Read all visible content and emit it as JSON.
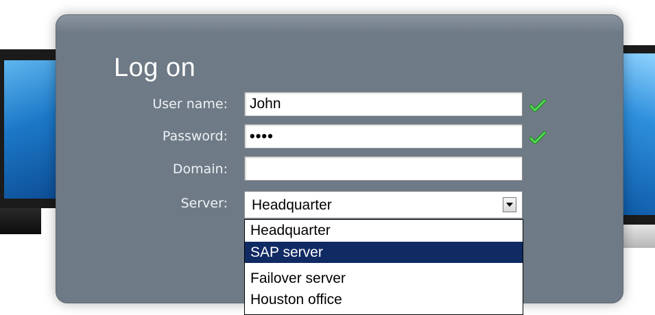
{
  "dialog": {
    "title": "Log on"
  },
  "form": {
    "username_label": "User name:",
    "username_value": "John",
    "password_label": "Password:",
    "password_value": "••••",
    "domain_label": "Domain:",
    "domain_value": "",
    "server_label": "Server:",
    "server_value": "Headquarter"
  },
  "server_dropdown": {
    "options": [
      "Headquarter",
      "SAP server",
      "Failover server",
      "Houston office"
    ],
    "highlighted_index": 1
  },
  "colors": {
    "panel": "#6e7a86",
    "highlight": "#102a63",
    "check": "#2fcc2f"
  },
  "icons": {
    "valid": "checkmark-icon",
    "dropdown": "chevron-down-icon"
  }
}
